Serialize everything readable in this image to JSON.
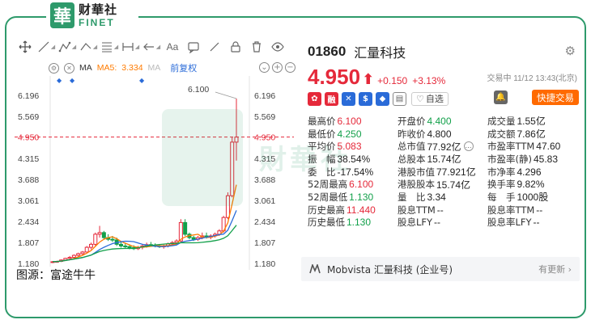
{
  "logo": {
    "badge": "華",
    "cn": "财華社",
    "en": "FINET"
  },
  "toolbar": {
    "items": [
      "crosshair-icon",
      "line-icon",
      "polyline-icon",
      "fib-icon",
      "hline-icon",
      "parallel-icon",
      "arrow-icon",
      "text-icon",
      "eraser-icon",
      "clear-icon",
      "eye-icon"
    ]
  },
  "ma_bar": {
    "ma_label": "MA",
    "ma5_label": "MA5:",
    "ma5_value": "3.334",
    "ma10_label": "MA",
    "fuquan": "前复权",
    "plus": "+",
    "minus": "−"
  },
  "chart_data": {
    "type": "candlestick",
    "y_ticks": [
      "6.196",
      "5.569",
      "4.950",
      "4.315",
      "3.688",
      "3.061",
      "2.434",
      "1.807",
      "1.180"
    ],
    "y_right_ticks": [
      "6.196",
      "5.569",
      "4.950",
      "4.315",
      "3.688",
      "3.061",
      "2.434",
      "1.807",
      "1.180"
    ],
    "ylim": [
      1.18,
      6.196
    ],
    "current_price_label": "4.950",
    "high_annotation": "6.100",
    "candles": [
      [
        1.22,
        1.25,
        1.19,
        1.23
      ],
      [
        1.23,
        1.26,
        1.2,
        1.24
      ],
      [
        1.24,
        1.3,
        1.22,
        1.28
      ],
      [
        1.28,
        1.35,
        1.25,
        1.33
      ],
      [
        1.33,
        1.4,
        1.3,
        1.36
      ],
      [
        1.36,
        1.45,
        1.3,
        1.42
      ],
      [
        1.42,
        1.5,
        1.38,
        1.47
      ],
      [
        1.47,
        1.55,
        1.42,
        1.52
      ],
      [
        1.52,
        1.7,
        1.5,
        1.66
      ],
      [
        1.66,
        1.8,
        1.6,
        1.75
      ],
      [
        1.75,
        2.1,
        1.7,
        2.05
      ],
      [
        2.05,
        2.3,
        1.95,
        2.1
      ],
      [
        2.1,
        2.15,
        1.9,
        1.95
      ],
      [
        1.95,
        2.05,
        1.85,
        1.9
      ],
      [
        1.9,
        2.0,
        1.82,
        1.88
      ],
      [
        1.88,
        1.95,
        1.7,
        1.75
      ],
      [
        1.75,
        1.85,
        1.65,
        1.7
      ],
      [
        1.7,
        1.78,
        1.62,
        1.68
      ],
      [
        1.68,
        1.75,
        1.6,
        1.65
      ],
      [
        1.65,
        1.72,
        1.58,
        1.62
      ],
      [
        1.62,
        1.7,
        1.58,
        1.66
      ],
      [
        1.66,
        1.75,
        1.6,
        1.7
      ],
      [
        1.7,
        1.8,
        1.65,
        1.74
      ],
      [
        1.74,
        1.82,
        1.68,
        1.72
      ],
      [
        1.72,
        1.78,
        1.66,
        1.7
      ],
      [
        1.7,
        1.76,
        1.64,
        1.68
      ],
      [
        1.68,
        1.74,
        1.62,
        1.7
      ],
      [
        1.7,
        1.8,
        1.66,
        1.76
      ],
      [
        1.76,
        1.85,
        1.7,
        1.8
      ],
      [
        1.8,
        1.9,
        1.75,
        1.85
      ],
      [
        1.85,
        2.5,
        1.82,
        2.4
      ],
      [
        2.4,
        2.5,
        2.0,
        2.05
      ],
      [
        2.05,
        2.1,
        1.9,
        1.95
      ],
      [
        1.95,
        2.0,
        1.85,
        1.9
      ],
      [
        1.9,
        2.0,
        1.85,
        1.95
      ],
      [
        1.95,
        2.1,
        1.9,
        2.0
      ],
      [
        2.0,
        2.1,
        1.92,
        1.96
      ],
      [
        1.96,
        2.05,
        1.9,
        2.0
      ],
      [
        2.0,
        2.1,
        1.95,
        2.05
      ],
      [
        2.05,
        2.2,
        2.0,
        2.15
      ],
      [
        2.15,
        2.6,
        2.1,
        2.55
      ],
      [
        2.55,
        3.3,
        2.5,
        3.2
      ],
      [
        3.2,
        4.95,
        3.15,
        4.8
      ],
      [
        4.8,
        6.1,
        4.25,
        4.95
      ]
    ]
  },
  "watermark": {
    "text": "財華社"
  },
  "source": "图源：富途牛牛",
  "stock": {
    "code": "01860",
    "name": "汇量科技",
    "price": "4.950",
    "arrow": "⬆",
    "change": "+0.150",
    "change_pct": "+3.13%",
    "status": "交易中 11/12 13:43(北京)",
    "zixuan": "自选",
    "quick_trade": "快捷交易"
  },
  "badges": [
    {
      "glyph": "✿",
      "color": "#e5293a"
    },
    {
      "glyph": "融",
      "color": "#e5293a"
    },
    {
      "glyph": "✕",
      "color": "#2a6bd8"
    },
    {
      "glyph": "$",
      "color": "#2a6bd8"
    },
    {
      "glyph": "◆",
      "color": "#2a6bd8"
    },
    {
      "glyph": "▤",
      "color": "#666666"
    }
  ],
  "stats": [
    [
      {
        "l": "最高价",
        "v": "6.100",
        "c": "red"
      },
      {
        "l": "开盘价",
        "v": "4.400",
        "c": "green"
      },
      {
        "l": "成交量",
        "v": "1.55亿",
        "c": "dark"
      }
    ],
    [
      {
        "l": "最低价",
        "v": "4.250",
        "c": "green"
      },
      {
        "l": "昨收价",
        "v": "4.800",
        "c": "dark"
      },
      {
        "l": "成交额",
        "v": "7.86亿",
        "c": "dark"
      }
    ],
    [
      {
        "l": "平均价",
        "v": "5.083",
        "c": "red"
      },
      {
        "l": "总市值",
        "v": "77.92亿",
        "c": "dark",
        "dots": true
      },
      {
        "l": "市盈率TTM",
        "v": "47.60",
        "c": "dark"
      }
    ],
    [
      {
        "l": "振　幅",
        "v": "38.54%",
        "c": "dark"
      },
      {
        "l": "总股本",
        "v": "15.74亿",
        "c": "dark"
      },
      {
        "l": "市盈率(静)",
        "v": "45.83",
        "c": "dark"
      }
    ],
    [
      {
        "l": "委　比",
        "v": "-17.54%",
        "c": "dark"
      },
      {
        "l": "港股市值",
        "v": "77.921亿",
        "c": "dark"
      },
      {
        "l": "市净率",
        "v": "4.296",
        "c": "dark"
      }
    ],
    [
      {
        "l": "52周最高",
        "v": "6.100",
        "c": "red"
      },
      {
        "l": "港股股本",
        "v": "15.74亿",
        "c": "dark"
      },
      {
        "l": "换手率",
        "v": "9.82%",
        "c": "dark"
      }
    ],
    [
      {
        "l": "52周最低",
        "v": "1.130",
        "c": "green"
      },
      {
        "l": "量　比",
        "v": "3.34",
        "c": "dark"
      },
      {
        "l": "每　手",
        "v": "1000股",
        "c": "dark"
      }
    ],
    [
      {
        "l": "历史最高",
        "v": "11.440",
        "c": "red"
      },
      {
        "l": "股息TTM",
        "v": "--",
        "c": "dark"
      },
      {
        "l": "股息率TTM",
        "v": "--",
        "c": "dark"
      }
    ],
    [
      {
        "l": "历史最低",
        "v": "1.130",
        "c": "green"
      },
      {
        "l": "股息LFY",
        "v": "--",
        "c": "dark"
      },
      {
        "l": "股息率LFY",
        "v": "--",
        "c": "dark"
      }
    ]
  ],
  "company": {
    "label": "Mobvista 汇量科技 (企业号)",
    "more": "有更新 ›"
  },
  "colors": {
    "up": "#e5293a",
    "down": "#12a04a",
    "brand": "#2e9a6b",
    "ma5": "#ff7b00",
    "ma10": "#2a6bd8",
    "ma20": "#12a04a"
  }
}
